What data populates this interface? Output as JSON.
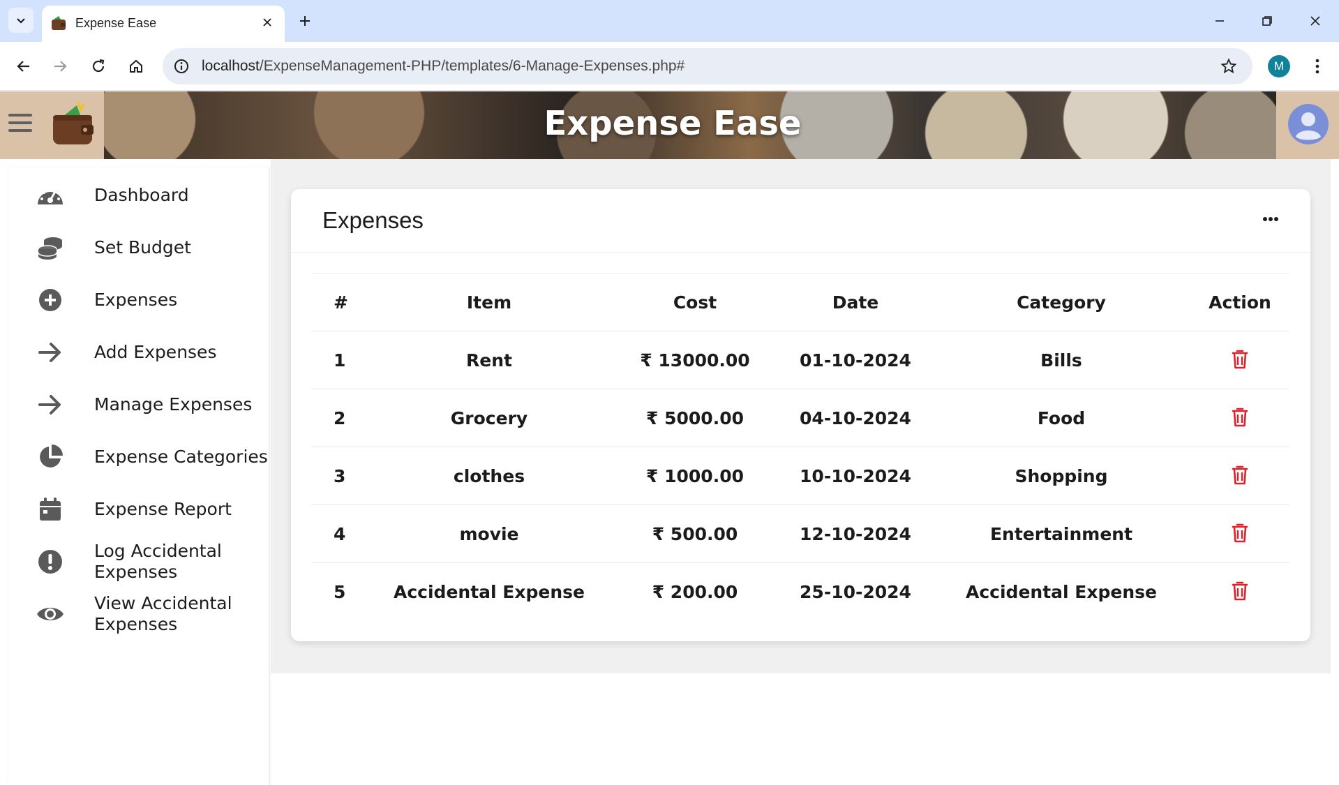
{
  "browser": {
    "tab_title": "Expense Ease",
    "url_host": "localhost",
    "url_path": "/ExpenseManagement-PHP/templates/6-Manage-Expenses.php#",
    "profile_initial": "M"
  },
  "header": {
    "app_title": "Expense Ease"
  },
  "sidebar": {
    "items": [
      {
        "label": "Dashboard",
        "icon": "gauge-icon"
      },
      {
        "label": "Set Budget",
        "icon": "coins-icon"
      },
      {
        "label": "Expenses",
        "icon": "plus-circle-icon"
      },
      {
        "label": "Add Expenses",
        "icon": "arrow-right-icon"
      },
      {
        "label": "Manage Expenses",
        "icon": "arrow-right-icon"
      },
      {
        "label": "Expense Categories",
        "icon": "pie-chart-icon"
      },
      {
        "label": "Expense Report",
        "icon": "calendar-icon"
      },
      {
        "label": "Log Accidental Expenses",
        "icon": "exclamation-circle-icon"
      },
      {
        "label": "View Accidental Expenses",
        "icon": "eye-icon"
      }
    ]
  },
  "card": {
    "title": "Expenses"
  },
  "table": {
    "headers": [
      "#",
      "Item",
      "Cost",
      "Date",
      "Category",
      "Action"
    ],
    "rows": [
      {
        "num": "1",
        "item": "Rent",
        "cost": "₹ 13000.00",
        "date": "01-10-2024",
        "category": "Bills"
      },
      {
        "num": "2",
        "item": "Grocery",
        "cost": "₹ 5000.00",
        "date": "04-10-2024",
        "category": "Food"
      },
      {
        "num": "3",
        "item": "clothes",
        "cost": "₹ 1000.00",
        "date": "10-10-2024",
        "category": "Shopping"
      },
      {
        "num": "4",
        "item": "movie",
        "cost": "₹ 500.00",
        "date": "12-10-2024",
        "category": "Entertainment"
      },
      {
        "num": "5",
        "item": "Accidental Expense",
        "cost": "₹ 200.00",
        "date": "25-10-2024",
        "category": "Accidental Expense"
      }
    ]
  },
  "colors": {
    "delete_icon": "#e3202a",
    "header_bg": "#d9c2a7",
    "avatar": "#7b8fd8"
  }
}
